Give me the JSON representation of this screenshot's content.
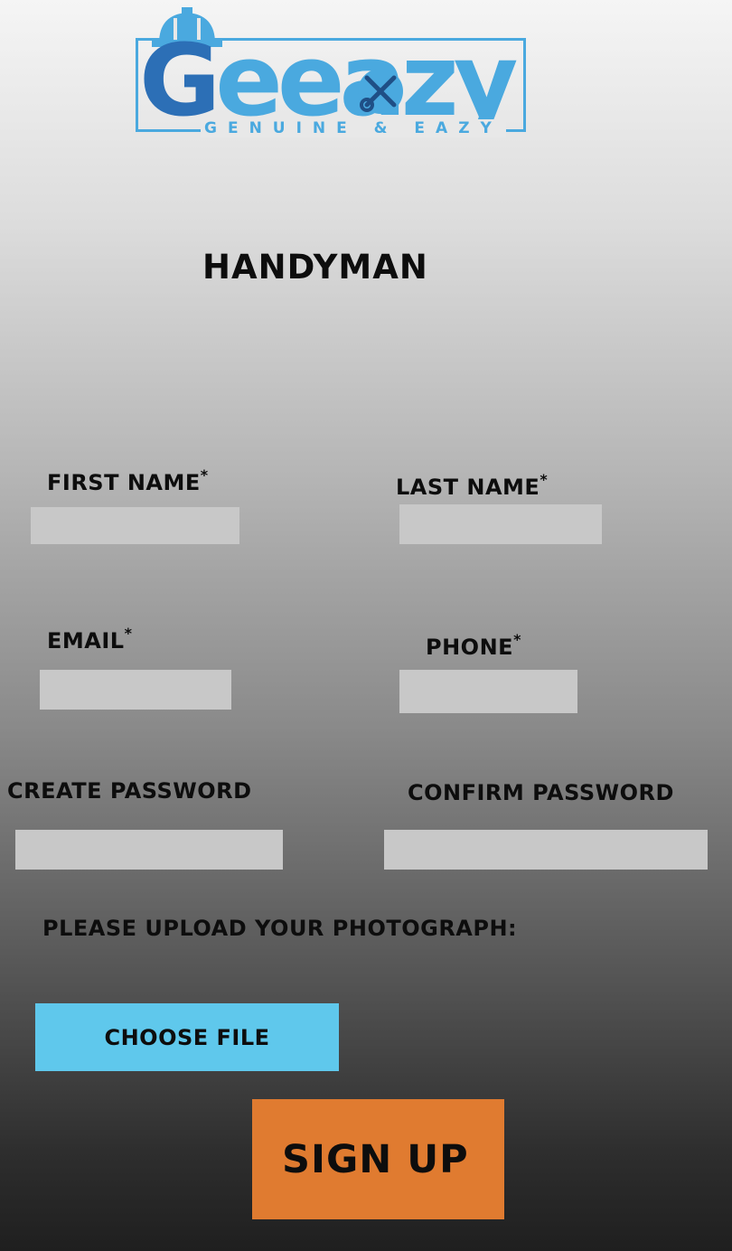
{
  "logo": {
    "word_first": "G",
    "word_rest": "eeazy",
    "tagline": "GENUINE & EAZY",
    "icons": [
      "hard-hat-icon",
      "wrench-screwdriver-icon"
    ],
    "colors": {
      "primary": "#2c6fb6",
      "secondary": "#4aa9df"
    }
  },
  "page_title": "HANDYMAN",
  "form": {
    "first_name": {
      "label": "FIRST NAME",
      "required_mark": "*",
      "value": ""
    },
    "last_name": {
      "label": "LAST NAME",
      "required_mark": "*",
      "value": ""
    },
    "email": {
      "label": "EMAIL",
      "required_mark": "*",
      "value": ""
    },
    "phone": {
      "label": "PHONE",
      "required_mark": "*",
      "value": ""
    },
    "create_password": {
      "label": "CREATE PASSWORD",
      "value": ""
    },
    "confirm_password": {
      "label": "CONFIRM PASSWORD",
      "value": ""
    },
    "upload_prompt": "PLEASE UPLOAD YOUR PHOTOGRAPH:",
    "choose_file_label": "CHOOSE FILE",
    "submit_label": "SIGN UP"
  },
  "colors": {
    "field_bg": "#c8c8c8",
    "choose_file_bg": "#5fc8ec",
    "submit_bg": "#e07b30",
    "text": "#0d0d0d"
  }
}
